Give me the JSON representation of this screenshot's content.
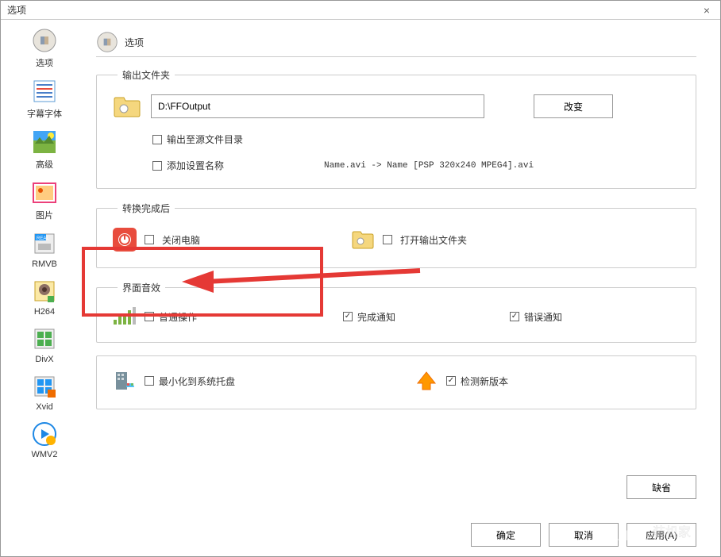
{
  "window": {
    "title": "选项",
    "close": "×"
  },
  "sidebar": {
    "items": [
      {
        "label": "选项",
        "name": "options"
      },
      {
        "label": "字幕字体",
        "name": "subtitle-font"
      },
      {
        "label": "高级",
        "name": "advanced"
      },
      {
        "label": "图片",
        "name": "picture"
      },
      {
        "label": "RMVB",
        "name": "rmvb"
      },
      {
        "label": "H264",
        "name": "h264"
      },
      {
        "label": "DivX",
        "name": "divx"
      },
      {
        "label": "Xvid",
        "name": "xvid"
      },
      {
        "label": "WMV2",
        "name": "wmv2"
      }
    ]
  },
  "header": {
    "title": "选项"
  },
  "output": {
    "legend": "输出文件夹",
    "path": "D:\\FFOutput",
    "change_label": "改变",
    "to_source_label": "输出至源文件目录",
    "add_setting_label": "添加设置名称",
    "hint": "Name.avi  -> Name [PSP 320x240 MPEG4].avi"
  },
  "after": {
    "legend": "转换完成后",
    "shutdown_label": "关闭电脑",
    "open_folder_label": "打开输出文件夹"
  },
  "sound": {
    "legend": "界面音效",
    "normal_label": "普通操作",
    "done_label": "完成通知",
    "error_label": "错误通知"
  },
  "misc": {
    "minimize_label": "最小化到系统托盘",
    "check_update_label": "检测新版本"
  },
  "buttons": {
    "default": "缺省",
    "ok": "确定",
    "cancel": "取消",
    "apply": "应用(A)"
  }
}
